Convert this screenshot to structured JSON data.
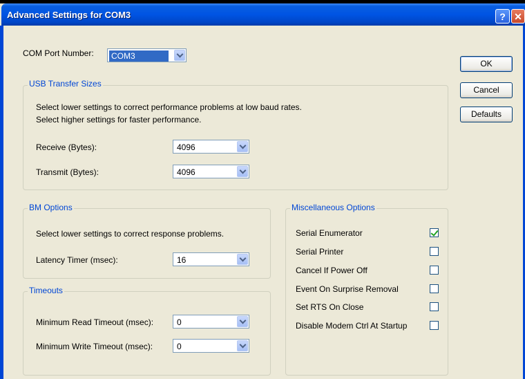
{
  "window": {
    "title": "Advanced Settings for COM3"
  },
  "com_port": {
    "label": "COM Port Number:",
    "value": "COM3"
  },
  "buttons": {
    "ok": "OK",
    "cancel": "Cancel",
    "defaults": "Defaults"
  },
  "usb": {
    "legend": "USB Transfer Sizes",
    "line1": "Select lower settings to correct performance problems at low baud rates.",
    "line2": "Select higher settings for faster performance.",
    "receive_label": "Receive (Bytes):",
    "receive_value": "4096",
    "transmit_label": "Transmit (Bytes):",
    "transmit_value": "4096"
  },
  "bm": {
    "legend": "BM Options",
    "desc": "Select lower settings to correct response problems.",
    "latency_label": "Latency Timer (msec):",
    "latency_value": "16"
  },
  "timeouts": {
    "legend": "Timeouts",
    "read_label": "Minimum Read Timeout (msec):",
    "read_value": "0",
    "write_label": "Minimum Write Timeout (msec):",
    "write_value": "0"
  },
  "misc": {
    "legend": "Miscellaneous Options",
    "options": [
      {
        "label": "Serial Enumerator",
        "checked": true
      },
      {
        "label": "Serial Printer",
        "checked": false
      },
      {
        "label": "Cancel If Power Off",
        "checked": false
      },
      {
        "label": "Event On Surprise Removal",
        "checked": false
      },
      {
        "label": "Set RTS On Close",
        "checked": false
      },
      {
        "label": "Disable Modem Ctrl At Startup",
        "checked": false
      }
    ]
  }
}
